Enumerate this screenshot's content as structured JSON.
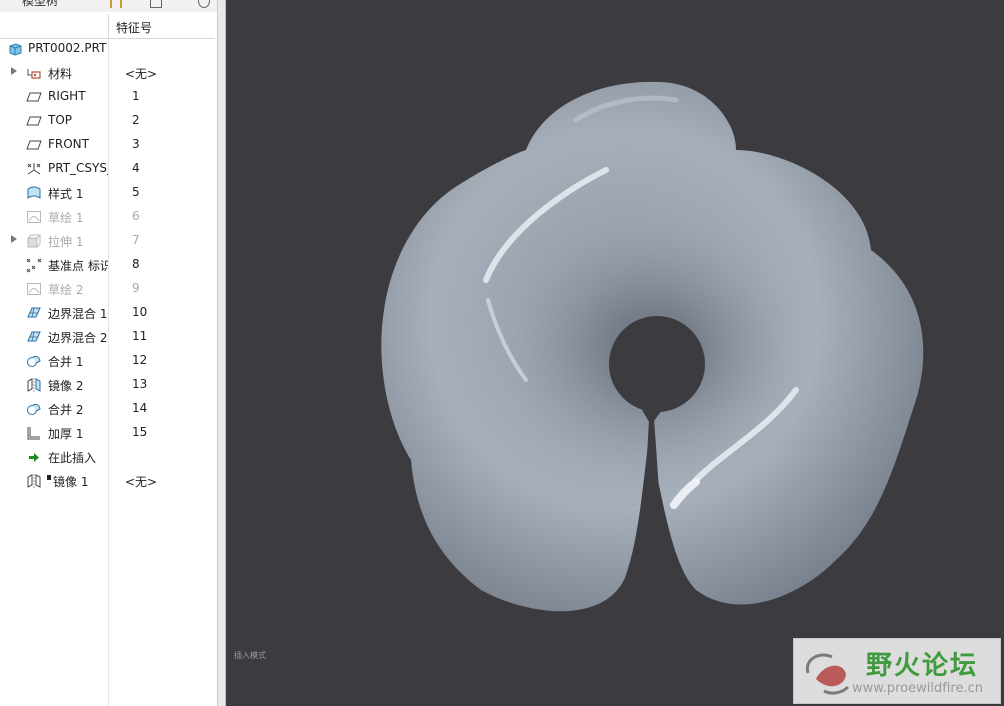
{
  "model_tree": {
    "title": "模型树",
    "column_header": "特征号",
    "items": [
      {
        "label": "PRT0002.PRT",
        "num": "",
        "icon": "part-icon"
      },
      {
        "label": "材料",
        "num": "<无>",
        "icon": "material-icon"
      },
      {
        "label": "RIGHT",
        "num": "1",
        "icon": "datum-plane-icon"
      },
      {
        "label": "TOP",
        "num": "2",
        "icon": "datum-plane-icon"
      },
      {
        "label": "FRONT",
        "num": "3",
        "icon": "datum-plane-icon"
      },
      {
        "label": "PRT_CSYS_",
        "num": "4",
        "icon": "csys-icon"
      },
      {
        "label": "样式 1",
        "num": "5",
        "icon": "style-icon"
      },
      {
        "label": "草绘 1",
        "num": "6",
        "icon": "sketch-icon"
      },
      {
        "label": "拉伸 1",
        "num": "7",
        "icon": "extrude-icon"
      },
      {
        "label": "基准点 标识",
        "num": "8",
        "icon": "datum-point-icon"
      },
      {
        "label": "草绘 2",
        "num": "9",
        "icon": "sketch-icon"
      },
      {
        "label": "边界混合 1",
        "num": "10",
        "icon": "boundary-blend-icon"
      },
      {
        "label": "边界混合 2",
        "num": "11",
        "icon": "boundary-blend-icon"
      },
      {
        "label": "合并 1",
        "num": "12",
        "icon": "merge-icon"
      },
      {
        "label": "镜像 2",
        "num": "13",
        "icon": "mirror-icon"
      },
      {
        "label": "合并 2",
        "num": "14",
        "icon": "merge-icon"
      },
      {
        "label": "加厚 1",
        "num": "15",
        "icon": "thicken-icon"
      },
      {
        "label": "在此插入",
        "num": "",
        "icon": "insert-here-icon"
      },
      {
        "label": "镜像 1",
        "num": "<无>",
        "icon": "mirror-icon"
      }
    ]
  },
  "viewport": {
    "mode_text": "插入模式"
  },
  "watermark": {
    "title": "野火论坛",
    "url": "www.proewildfire.cn"
  },
  "colors": {
    "viewport_bg": "#3b3b40",
    "model_surface": "#a4adb8",
    "watermark_green": "#3f9b3d",
    "dimmed_text": "#a9a9a9"
  }
}
